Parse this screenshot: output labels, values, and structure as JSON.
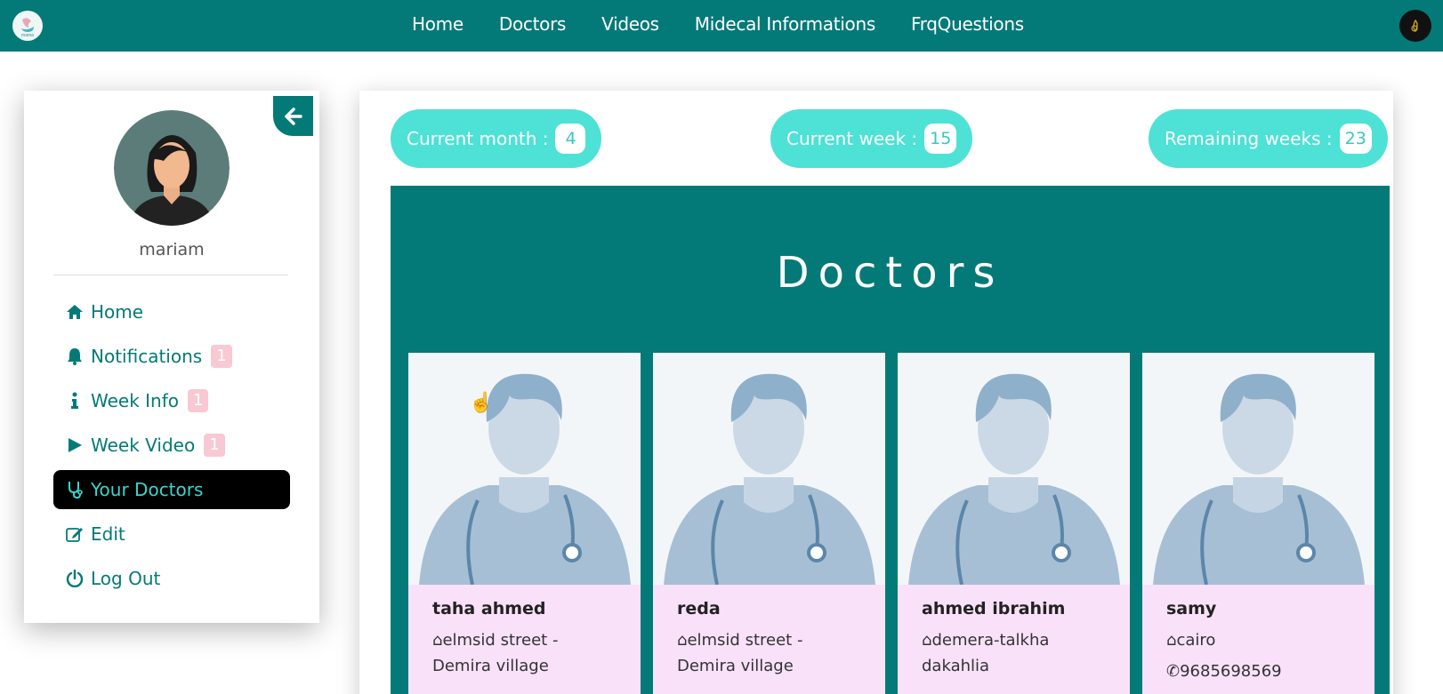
{
  "nav": {
    "links": [
      "Home",
      "Doctors",
      "Videos",
      "Midecal Informations",
      "FrqQuestions"
    ]
  },
  "sidebar": {
    "username": "mariam",
    "items": [
      {
        "label": "Home",
        "icon": "home-icon",
        "badge": ""
      },
      {
        "label": "Notifications",
        "icon": "bell-icon",
        "badge": "1"
      },
      {
        "label": "Week Info",
        "icon": "info-icon",
        "badge": "1"
      },
      {
        "label": "Week Video",
        "icon": "play-icon",
        "badge": "1"
      },
      {
        "label": "Your Doctors",
        "icon": "stethoscope-icon",
        "badge": "",
        "active": true
      },
      {
        "label": "Edit",
        "icon": "edit-icon",
        "badge": ""
      },
      {
        "label": "Log Out",
        "icon": "power-icon",
        "badge": ""
      }
    ]
  },
  "stats": {
    "month_label": "Current month :",
    "month_value": "4",
    "week_label": "Current week :",
    "week_value": "15",
    "remaining_label": "Remaining weeks :",
    "remaining_value": "23"
  },
  "doctors": {
    "title": "Doctors",
    "list": [
      {
        "name": "taha ahmed",
        "address": "elmsid street - Demira village",
        "phone": ""
      },
      {
        "name": "reda",
        "address": "elmsid street - Demira village",
        "phone": ""
      },
      {
        "name": "ahmed ibrahim",
        "address": "demera-talkha dakahlia",
        "phone": ""
      },
      {
        "name": "samy",
        "address": "cairo",
        "phone": "9685698569"
      }
    ]
  },
  "colors": {
    "primary": "#037a78",
    "accent": "#4ee1d6",
    "badge": "#f8c9d2",
    "card_body": "#f9e1fa"
  }
}
